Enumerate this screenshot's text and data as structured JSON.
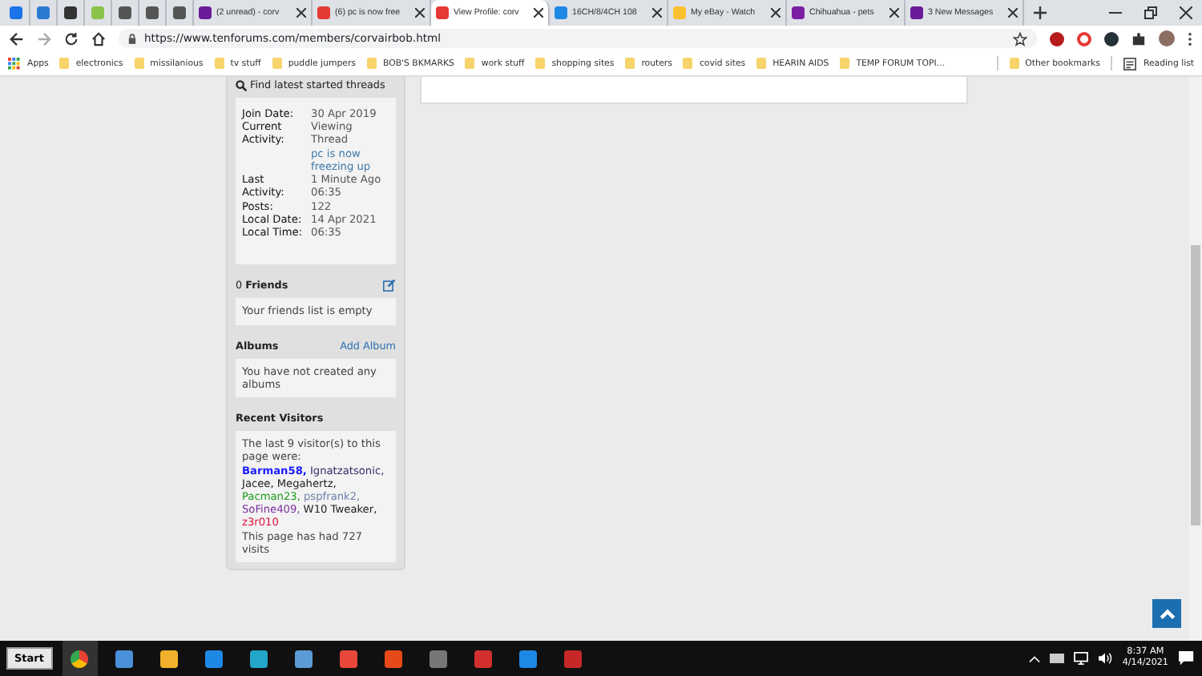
{
  "tabs": [
    {
      "kind": "pinned",
      "selected": false,
      "color": "#1a73e8"
    },
    {
      "kind": "pinned",
      "selected": false,
      "color": "#2a7ad2"
    },
    {
      "kind": "pinned",
      "selected": false,
      "color": "#333333"
    },
    {
      "kind": "pinned",
      "selected": false,
      "color": "#8bc34a"
    },
    {
      "kind": "pinned",
      "selected": false,
      "color": "#555555"
    },
    {
      "kind": "pinned",
      "selected": false,
      "color": "#555555"
    },
    {
      "kind": "pinned",
      "selected": false,
      "color": "#555555"
    },
    {
      "kind": "full",
      "title": "(2 unread) - corv",
      "selected": false,
      "color": "#6a1b9a"
    },
    {
      "kind": "full",
      "title": "(6) pc is now free",
      "selected": false,
      "color": "#e53935"
    },
    {
      "kind": "full",
      "title": "View Profile: corv",
      "selected": true,
      "color": "#e53935"
    },
    {
      "kind": "full",
      "title": "16CH/8/4CH 108",
      "selected": false,
      "color": "#1e88e5"
    },
    {
      "kind": "full",
      "title": "My eBay - Watch",
      "selected": false,
      "color": "#fbc02d"
    },
    {
      "kind": "full",
      "title": "Chihuahua - pets",
      "selected": false,
      "color": "#7b1fa2"
    },
    {
      "kind": "full",
      "title": "3 New Messages",
      "selected": false,
      "color": "#6a1b9a"
    }
  ],
  "address": {
    "url": "https://www.tenforums.com/members/corvairbob.html"
  },
  "bookmarks": [
    "Apps",
    "electronics",
    "missilanious",
    "tv stuff",
    "puddle jumpers",
    "BOB'S BKMARKS",
    "work stuff",
    "shopping sites",
    "routers",
    "covid sites",
    "HEARIN AIDS",
    "TEMP FORUM TOPI..."
  ],
  "other_bookmarks": "Other bookmarks",
  "reading_list": "Reading list",
  "profile": {
    "find_threads": "Find latest started threads",
    "details": [
      {
        "label": "Join Date:",
        "value": "30 Apr 2019",
        "link": false
      },
      {
        "label": "Current Activity:",
        "value": "Viewing Thread",
        "link": false
      },
      {
        "value": "pc is now freezing up",
        "link": true
      },
      {
        "label": "Last Activity:",
        "value": "1 Minute Ago 06:35",
        "link": false
      },
      {
        "label": "Posts:",
        "value": "122",
        "link": false
      },
      {
        "label": "Local Date:",
        "value": "14 Apr 2021",
        "link": false
      },
      {
        "label": "Local Time:",
        "value": "06:35",
        "link": false
      }
    ],
    "friends": {
      "count": "0",
      "title": "Friends",
      "text": "Your friends list is empty"
    },
    "albums": {
      "title": "Albums",
      "action": "Add Album",
      "text": "You have not created any albums"
    },
    "visitors": {
      "title": "Recent Visitors",
      "intro": "The last 9 visitor(s) to this page were:",
      "names": [
        {
          "name": "Barman58,",
          "color": "#1a1aff"
        },
        {
          "name": "Ignatzatsonic,",
          "color": "#3b2a6b"
        },
        {
          "name": "Jacee,",
          "color": "#222222"
        },
        {
          "name": "Megahertz,",
          "color": "#222222"
        },
        {
          "name": "Pacman23,",
          "color": "#1e9e1e"
        },
        {
          "name": "pspfrank2,",
          "color": "#6b7fa8"
        },
        {
          "name": "SoFine409,",
          "color": "#7b2fa0"
        },
        {
          "name": "W10 Tweaker,",
          "color": "#222222"
        },
        {
          "name": "z3r010",
          "color": "#e0103a"
        }
      ],
      "footer": "This page has had 727 visits"
    }
  },
  "taskbar": {
    "start": "Start",
    "time": "8:37 AM",
    "date": "4/14/2021"
  }
}
